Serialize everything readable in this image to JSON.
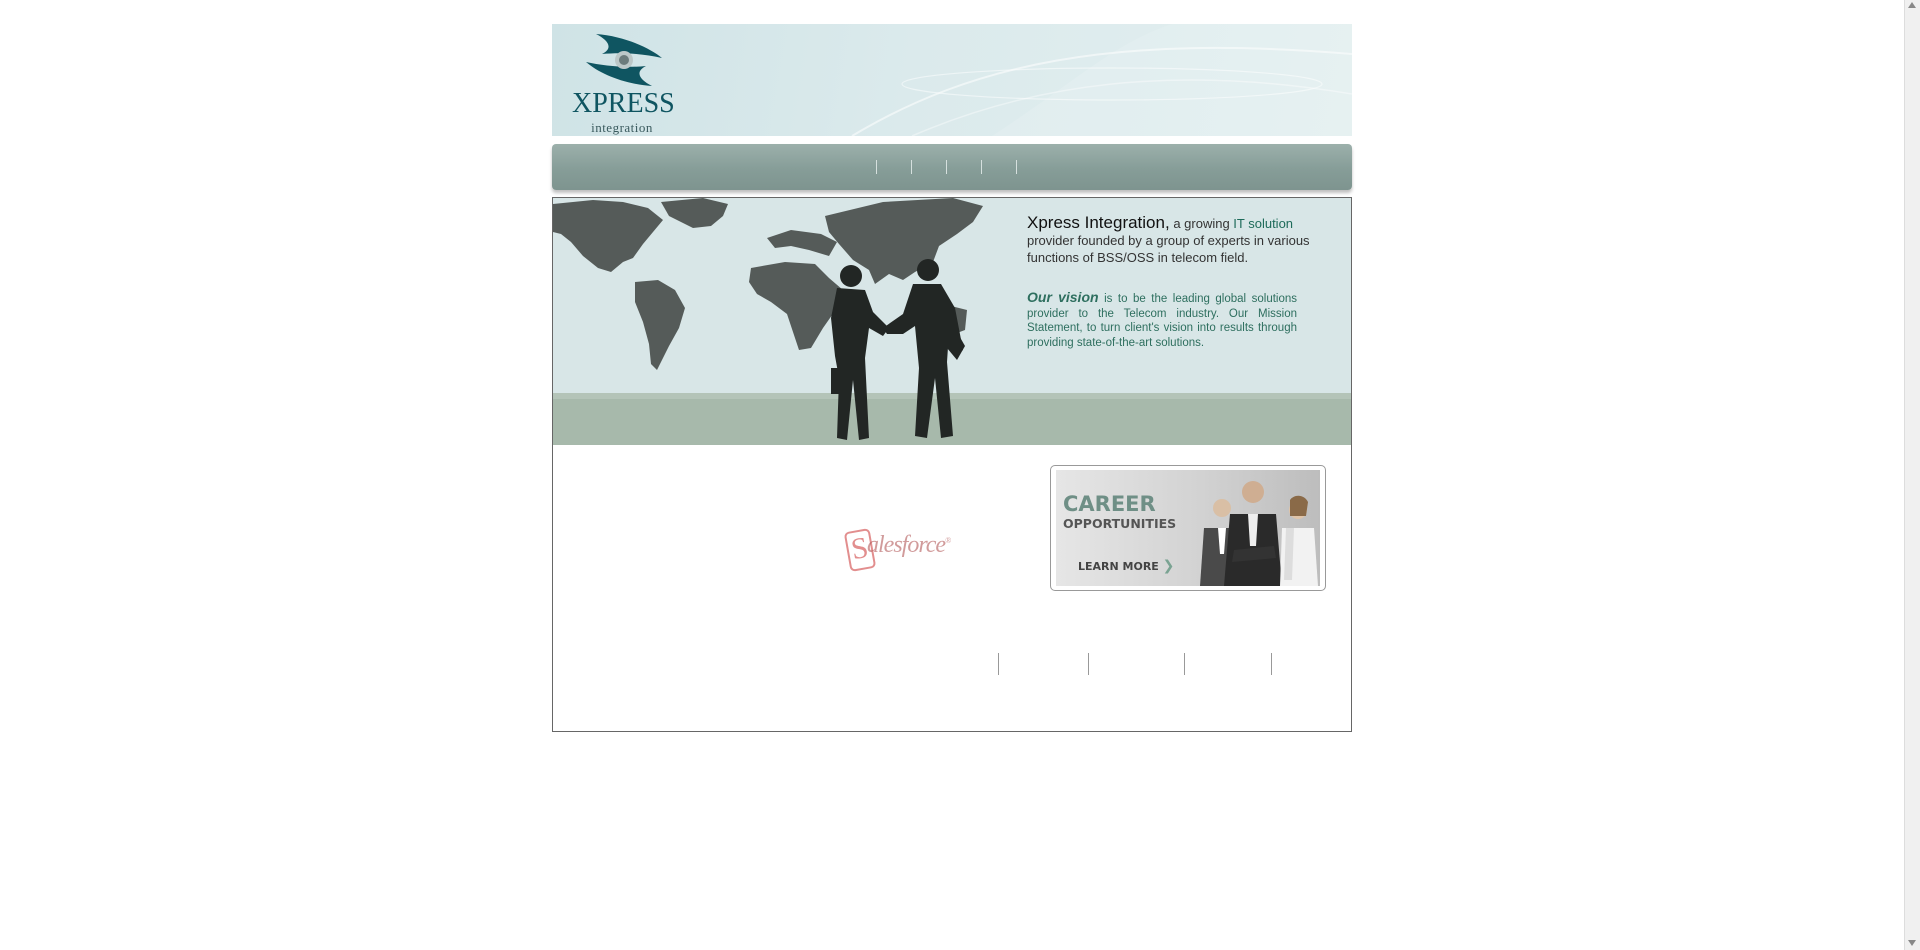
{
  "header": {
    "logo": {
      "word": "XPRESS",
      "sub": "integration"
    }
  },
  "nav": {
    "items": [
      "",
      "",
      "",
      "",
      ""
    ]
  },
  "hero": {
    "company": "Xpress Integration,",
    "intro_a": " a growing ",
    "intro_hl": "IT solution",
    "intro_b": " provider founded by a group of experts in various functions of BSS/OSS in telecom field.",
    "vision_label": "Our vision",
    "vision_text": " is to be the leading global solutions provider to the Telecom industry. Our Mission Statement, to turn client's vision into results through providing state-of-the-art solutions."
  },
  "partner": {
    "logo_text": "alesforce",
    "logo_s": "S",
    "trademark": "®"
  },
  "career": {
    "title": "CAREER",
    "subtitle": "OPPORTUNITIES",
    "cta": "LEARN MORE",
    "cta_arrow": "❯"
  },
  "footer": {
    "links": [
      "",
      "",
      "",
      ""
    ]
  },
  "colors": {
    "brand": "#0f5561",
    "accent": "#2e6f5f",
    "nav": "#869d98"
  }
}
